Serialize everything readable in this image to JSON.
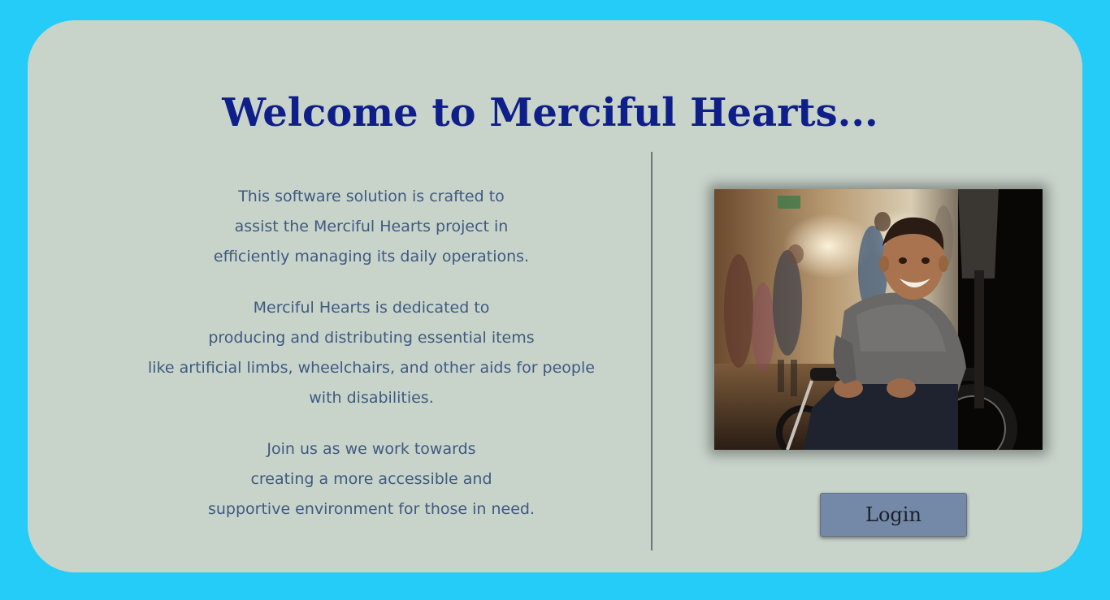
{
  "header": {
    "title": "Welcome to Merciful Hearts..."
  },
  "intro": {
    "paragraph1": [
      "This software solution is crafted to",
      "assist the Merciful Hearts project in",
      "efficiently managing its daily operations."
    ],
    "paragraph2": [
      "Merciful Hearts is dedicated to",
      "producing and distributing essential items",
      "like artificial limbs, wheelchairs, and other aids for people",
      "with disabilities."
    ],
    "paragraph3": [
      "Join us as we work towards",
      "creating a more accessible and",
      "supportive environment for those in need."
    ]
  },
  "actions": {
    "login_label": "Login"
  },
  "colors": {
    "background": "#25CCF7",
    "card": "#C8D3CA",
    "title": "#0F1F8A",
    "body_text": "#3F5A80",
    "button": "#7489A8"
  }
}
